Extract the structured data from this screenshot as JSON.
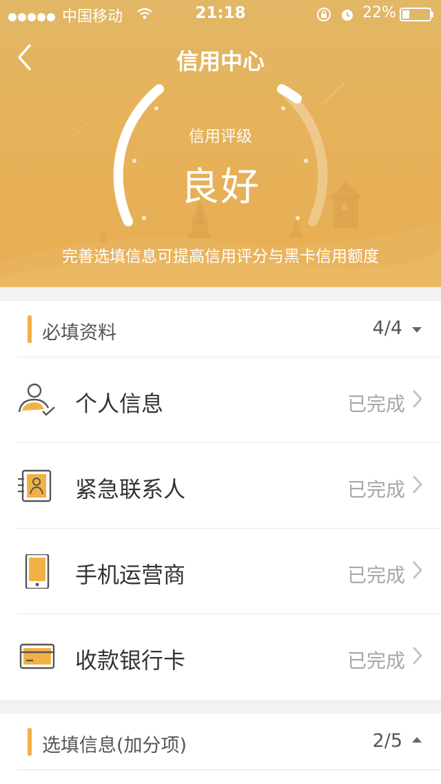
{
  "status_bar": {
    "carrier": "中国移动",
    "time": "21:18",
    "battery": "22%"
  },
  "nav": {
    "title": "信用中心"
  },
  "credit": {
    "label": "信用评级",
    "rating": "良好",
    "hint": "完善选填信息可提高信用评分与黑卡信用额度"
  },
  "required_section": {
    "title": "必填资料",
    "count": "4/4",
    "items": [
      {
        "label": "个人信息",
        "status": "已完成",
        "icon": "person-check-icon"
      },
      {
        "label": "紧急联系人",
        "status": "已完成",
        "icon": "contact-card-icon"
      },
      {
        "label": "手机运营商",
        "status": "已完成",
        "icon": "phone-icon"
      },
      {
        "label": "收款银行卡",
        "status": "已完成",
        "icon": "bank-card-icon"
      }
    ]
  },
  "optional_section": {
    "title": "选填信息(加分项)",
    "count": "2/5"
  },
  "colors": {
    "header": "#e6b25b",
    "accent": "#f2b145",
    "status_text": "#a7a7a7"
  }
}
